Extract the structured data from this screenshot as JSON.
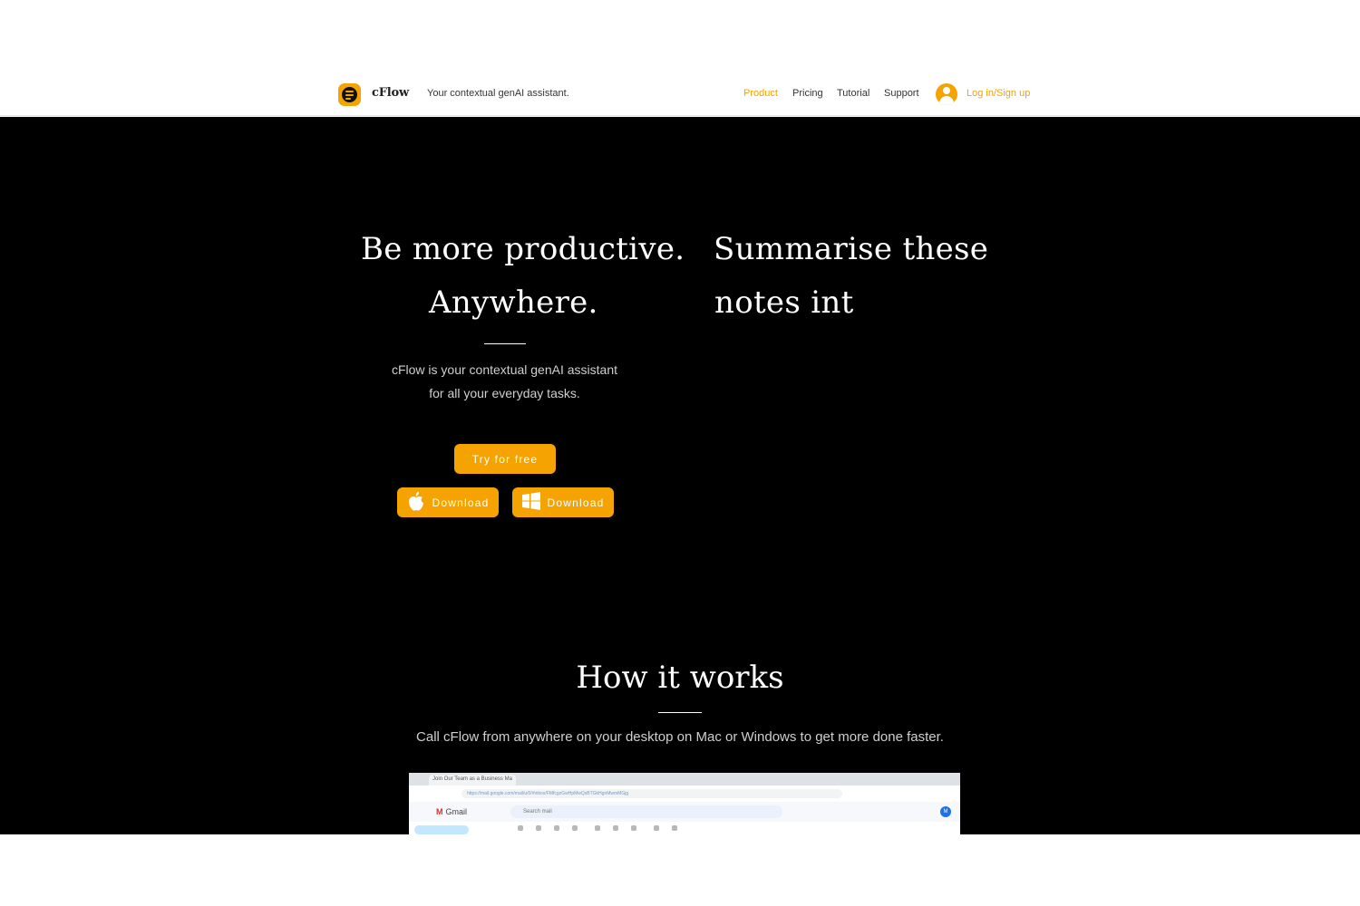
{
  "header": {
    "brand": "cFlow",
    "tagline": "Your contextual genAI assistant.",
    "nav": [
      "Product",
      "Pricing",
      "Tutorial",
      "Support"
    ],
    "active_nav": "Product",
    "login": "Log in/Sign up"
  },
  "hero": {
    "headline_left_1": "Be more productive.",
    "headline_left_2": "Anywhere.",
    "headline_right_1": "Summarise these",
    "headline_right_2": "notes int",
    "desc_1": "cFlow is your contextual genAI assistant",
    "desc_2": "for all your everyday tasks.",
    "try_button": "Try for free",
    "mac_download": "Download",
    "win_download": "Download"
  },
  "how": {
    "title": "How it works",
    "desc": "Call cFlow from anywhere on your desktop on Mac or Windows to get more done faster."
  },
  "screenshot": {
    "tab": "Join Our Team as a Business Ma",
    "url": "https://mail.google.com/mail/u/0/#inbox/FMfcgzGwHpMwQsBTGkHgnMwmMGjg",
    "gmail": "Gmail",
    "search": "Search mail",
    "avatar": "M"
  },
  "colors": {
    "accent": "#f5a300",
    "hero_bg": "#000000",
    "header_bg": "#ffffff"
  },
  "icons": [
    "cflow-logo-icon",
    "user-avatar-icon",
    "apple-icon",
    "windows-icon"
  ]
}
